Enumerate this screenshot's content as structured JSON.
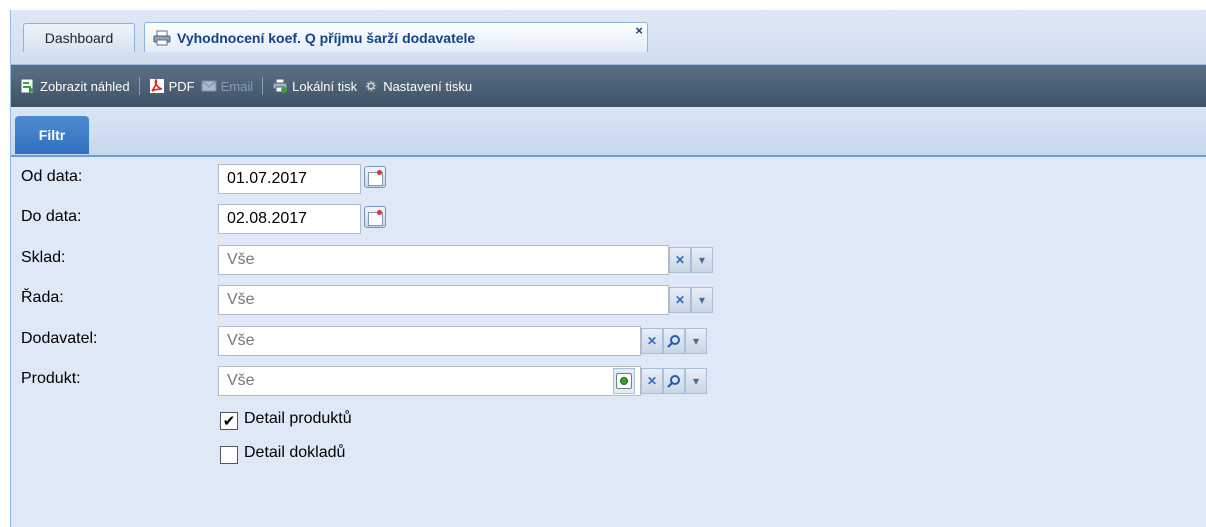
{
  "tabs": {
    "dashboard_label": "Dashboard",
    "active_label": "Vyhodnocení koef. Q příjmu šarží dodavatele",
    "close_glyph": "×"
  },
  "toolbar": {
    "preview_label": "Zobrazit náhled",
    "pdf_label": "PDF",
    "email_label": "Email",
    "local_print_label": "Lokální tisk",
    "print_settings_label": "Nastavení tisku"
  },
  "filter_tab": {
    "label": "Filtr"
  },
  "form": {
    "od_data": {
      "label": "Od data:",
      "value": "01.07.2017"
    },
    "do_data": {
      "label": "Do data:",
      "value": "02.08.2017"
    },
    "sklad": {
      "label": "Sklad:",
      "placeholder": "Vše"
    },
    "rada": {
      "label": "Řada:",
      "placeholder": "Vše"
    },
    "dodavatel": {
      "label": "Dodavatel:",
      "placeholder": "Vše"
    },
    "produkt": {
      "label": "Produkt:",
      "placeholder": "Vše"
    },
    "detail_produktu": {
      "label": "Detail produktů",
      "checked": true,
      "glyph": "✔"
    },
    "detail_dokladu": {
      "label": "Detail dokladů",
      "checked": false,
      "glyph": ""
    }
  },
  "colors": {
    "toolbar_bg": "#4a5f75",
    "filter_tab_bg": "#3a7cc9",
    "accent": "#15428b"
  },
  "icons": [
    "print-icon",
    "preview-icon",
    "pdf-icon",
    "email-icon",
    "local-print-icon",
    "gear-icon",
    "calendar-icon",
    "clear-icon",
    "dropdown-icon",
    "search-icon",
    "add-icon",
    "checkbox-icon"
  ]
}
